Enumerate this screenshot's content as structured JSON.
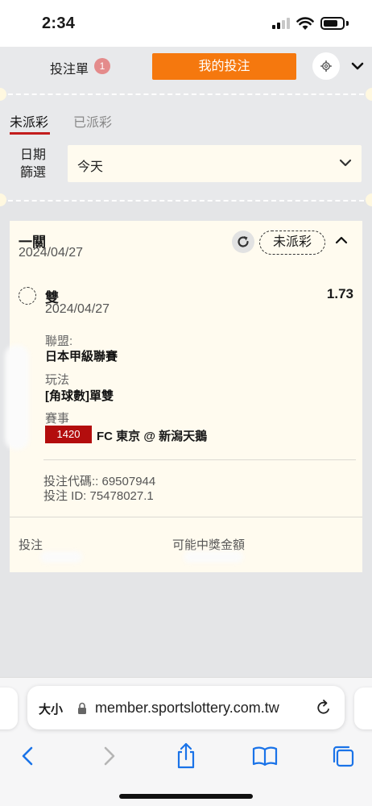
{
  "status_bar": {
    "time": "2:34"
  },
  "header": {
    "betslip_label": "投注單",
    "betslip_count": "1",
    "my_bets_label": "我的投注",
    "accent": "#f5780e"
  },
  "tabs": [
    {
      "label": "未派彩",
      "active": true
    },
    {
      "label": "已派彩",
      "active": false
    }
  ],
  "filter": {
    "label": "日期\n篩選",
    "value": "今天"
  },
  "bet": {
    "type": "一關",
    "date": "2024/04/27",
    "status": "未派彩",
    "selection": "雙",
    "selection_date": "2024/04/27",
    "odds": "1.73",
    "league_label": "聯盟:",
    "league": "日本甲級聯賽",
    "market_label": "玩法",
    "market": "[角球數]單雙",
    "event_label": "賽事",
    "event_code": "1420",
    "event_name": "FC 東京 @ 新潟天鵝",
    "bet_code": "投注代碼:: 69507944",
    "bet_id": "投注 ID: 75478027.1",
    "stake_label": "投注",
    "payout_label": "可能中獎金額"
  },
  "browser": {
    "text_size": "大小",
    "url": "member.sportslottery.com.tw"
  }
}
